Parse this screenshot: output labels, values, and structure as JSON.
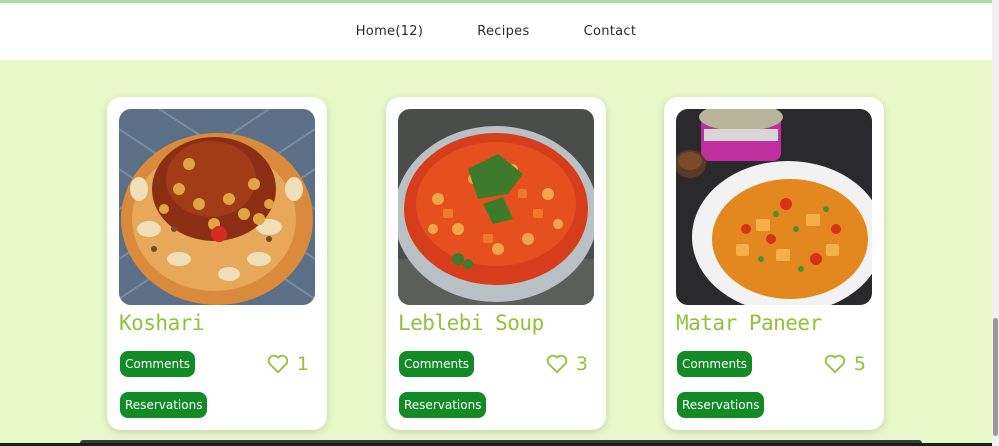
{
  "nav": {
    "items": [
      {
        "label": "Home(12)"
      },
      {
        "label": "Recipes"
      },
      {
        "label": "Contact"
      }
    ]
  },
  "colors": {
    "background": "#e8f8c8",
    "title": "#94c13a",
    "button": "#128a25",
    "card": "#ffffff"
  },
  "cards": [
    {
      "title": "Koshari",
      "comments_label": "Comments",
      "reservations_label": "Reservations",
      "likes": "1",
      "image": "koshari-photo"
    },
    {
      "title": "Leblebi Soup",
      "comments_label": "Comments",
      "reservations_label": "Reservations",
      "likes": "3",
      "image": "leblebi-soup-photo"
    },
    {
      "title": "Matar Paneer",
      "comments_label": "Comments",
      "reservations_label": "Reservations",
      "likes": "5",
      "image": "matar-paneer-photo"
    }
  ]
}
